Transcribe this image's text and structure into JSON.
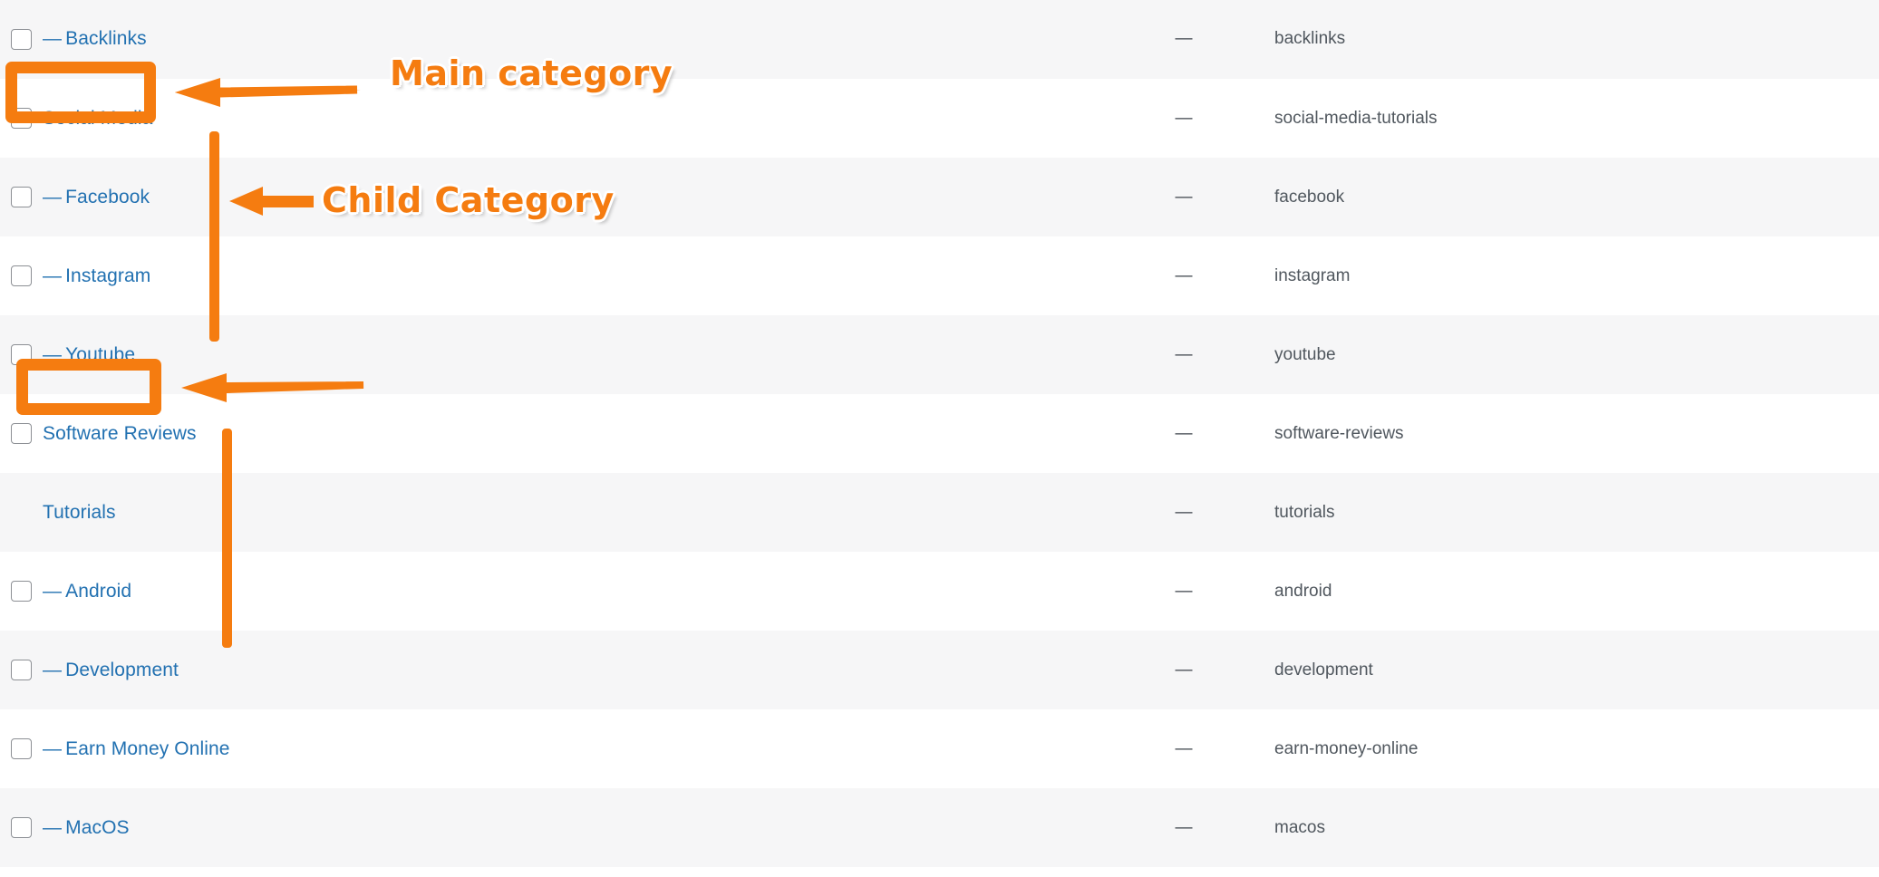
{
  "accent_color": "#f57c10",
  "link_color": "#2271b1",
  "table": {
    "columns": [
      "checkbox",
      "name",
      "description",
      "slug"
    ],
    "rows": [
      {
        "indent": true,
        "prefix": "—",
        "name": "Backlinks",
        "description": "—",
        "slug": "backlinks",
        "stripe": "alt",
        "checkbox": true
      },
      {
        "indent": false,
        "prefix": "",
        "name": "Social Media",
        "description": "—",
        "slug": "social-media-tutorials",
        "stripe": "plain",
        "checkbox": true
      },
      {
        "indent": true,
        "prefix": "—",
        "name": "Facebook",
        "description": "—",
        "slug": "facebook",
        "stripe": "alt",
        "checkbox": true
      },
      {
        "indent": true,
        "prefix": "—",
        "name": "Instagram",
        "description": "—",
        "slug": "instagram",
        "stripe": "plain",
        "checkbox": true
      },
      {
        "indent": true,
        "prefix": "—",
        "name": "Youtube",
        "description": "—",
        "slug": "youtube",
        "stripe": "alt",
        "checkbox": true
      },
      {
        "indent": false,
        "prefix": "",
        "name": "Software Reviews",
        "description": "—",
        "slug": "software-reviews",
        "stripe": "plain",
        "checkbox": true
      },
      {
        "indent": false,
        "prefix": "",
        "name": "Tutorials",
        "description": "—",
        "slug": "tutorials",
        "stripe": "alt",
        "checkbox": false
      },
      {
        "indent": true,
        "prefix": "—",
        "name": "Android",
        "description": "—",
        "slug": "android",
        "stripe": "plain",
        "checkbox": true
      },
      {
        "indent": true,
        "prefix": "—",
        "name": "Development",
        "description": "—",
        "slug": "development",
        "stripe": "alt",
        "checkbox": true
      },
      {
        "indent": true,
        "prefix": "—",
        "name": "Earn Money Online",
        "description": "—",
        "slug": "earn-money-online",
        "stripe": "plain",
        "checkbox": true
      },
      {
        "indent": true,
        "prefix": "—",
        "name": "MacOS",
        "description": "—",
        "slug": "macos",
        "stripe": "alt",
        "checkbox": true
      }
    ]
  },
  "annotations": {
    "main_category_label": "Main category",
    "child_category_label": "Child Category",
    "highlight_main": "Social Media",
    "highlight_parent": "Tutorials"
  }
}
